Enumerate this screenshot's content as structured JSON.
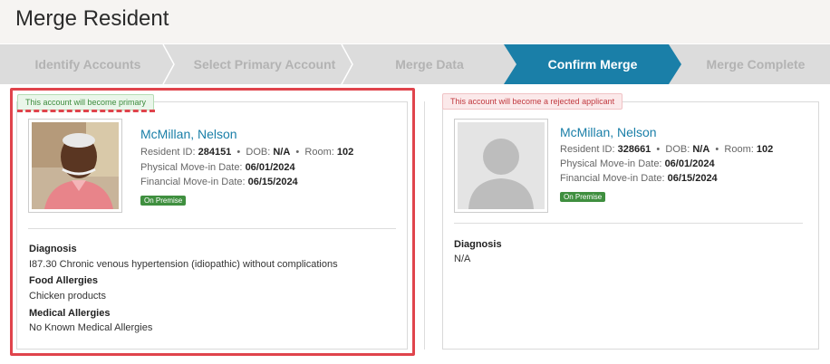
{
  "page": {
    "title": "Merge Resident"
  },
  "steps": [
    {
      "label": "Identify Accounts",
      "active": false
    },
    {
      "label": "Select Primary Account",
      "active": false
    },
    {
      "label": "Merge Data",
      "active": false
    },
    {
      "label": "Confirm Merge",
      "active": true
    },
    {
      "label": "Merge Complete",
      "active": false
    }
  ],
  "colors": {
    "accent": "#1a7fa8",
    "highlight": "#e0444c",
    "badge_green": "#3f8f3f"
  },
  "left": {
    "tag": "This account will become primary",
    "name": "McMillan, Nelson",
    "resident_id_label": "Resident ID:",
    "resident_id": "284151",
    "dob_label": "DOB:",
    "dob": "N/A",
    "room_label": "Room:",
    "room": "102",
    "physical_label": "Physical Move-in Date:",
    "physical": "06/01/2024",
    "financial_label": "Financial Move-in Date:",
    "financial": "06/15/2024",
    "badge": "On Premise",
    "diagnosis_title": "Diagnosis",
    "diagnosis": "I87.30 Chronic venous hypertension (idiopathic) without complications",
    "food_title": "Food Allergies",
    "food": "Chicken products",
    "medical_title": "Medical Allergies",
    "medical": "No Known Medical Allergies",
    "photo_icon": "resident-photo"
  },
  "right": {
    "tag": "This account will become a rejected applicant",
    "name": "McMillan, Nelson",
    "resident_id_label": "Resident ID:",
    "resident_id": "328661",
    "dob_label": "DOB:",
    "dob": "N/A",
    "room_label": "Room:",
    "room": "102",
    "physical_label": "Physical Move-in Date:",
    "physical": "06/01/2024",
    "financial_label": "Financial Move-in Date:",
    "financial": "06/15/2024",
    "badge": "On Premise",
    "diagnosis_title": "Diagnosis",
    "diagnosis": "N/A",
    "photo_icon": "avatar-placeholder-icon"
  }
}
